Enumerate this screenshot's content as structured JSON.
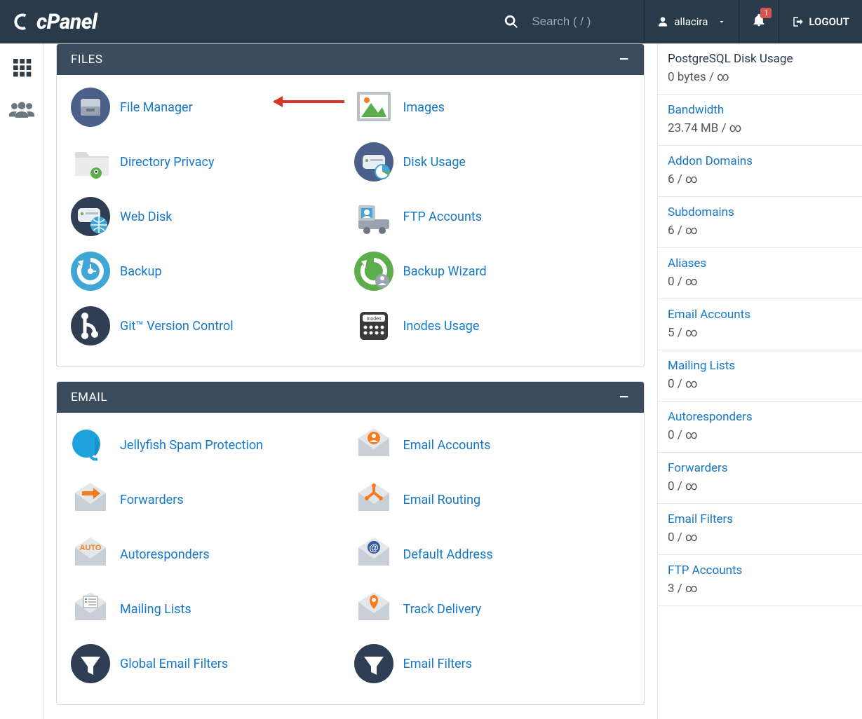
{
  "header": {
    "brand": "cPanel",
    "search_placeholder": "Search ( / )",
    "username": "allacira",
    "notification_count": "1",
    "logout_label": "LOGOUT"
  },
  "sections": [
    {
      "title": "FILES",
      "items": [
        {
          "label": "File Manager",
          "icon": "file-manager"
        },
        {
          "label": "Images",
          "icon": "images"
        },
        {
          "label": "Directory Privacy",
          "icon": "directory-privacy"
        },
        {
          "label": "Disk Usage",
          "icon": "disk-usage"
        },
        {
          "label": "Web Disk",
          "icon": "web-disk"
        },
        {
          "label": "FTP Accounts",
          "icon": "ftp-accounts"
        },
        {
          "label": "Backup",
          "icon": "backup"
        },
        {
          "label": "Backup Wizard",
          "icon": "backup-wizard"
        },
        {
          "label": "Git™ Version Control",
          "icon": "git"
        },
        {
          "label": "Inodes Usage",
          "icon": "inodes"
        }
      ]
    },
    {
      "title": "EMAIL",
      "items": [
        {
          "label": "Jellyfish Spam Protection",
          "icon": "jellyfish"
        },
        {
          "label": "Email Accounts",
          "icon": "email-accounts"
        },
        {
          "label": "Forwarders",
          "icon": "forwarders"
        },
        {
          "label": "Email Routing",
          "icon": "email-routing"
        },
        {
          "label": "Autoresponders",
          "icon": "autoresponders"
        },
        {
          "label": "Default Address",
          "icon": "default-address"
        },
        {
          "label": "Mailing Lists",
          "icon": "mailing-lists"
        },
        {
          "label": "Track Delivery",
          "icon": "track-delivery"
        },
        {
          "label": "Global Email Filters",
          "icon": "global-filters"
        },
        {
          "label": "Email Filters",
          "icon": "email-filters"
        }
      ]
    }
  ],
  "stats": [
    {
      "title": "PostgreSQL Disk Usage",
      "value": "0 bytes / ∞",
      "link": false
    },
    {
      "title": "Bandwidth",
      "value": "23.74 MB / ∞",
      "link": true
    },
    {
      "title": "Addon Domains",
      "value": "6 / ∞",
      "link": true
    },
    {
      "title": "Subdomains",
      "value": "6 / ∞",
      "link": true
    },
    {
      "title": "Aliases",
      "value": "0 / ∞",
      "link": true
    },
    {
      "title": "Email Accounts",
      "value": "5 / ∞",
      "link": true
    },
    {
      "title": "Mailing Lists",
      "value": "0 / ∞",
      "link": true
    },
    {
      "title": "Autoresponders",
      "value": "0 / ∞",
      "link": true
    },
    {
      "title": "Forwarders",
      "value": "0 / ∞",
      "link": true
    },
    {
      "title": "Email Filters",
      "value": "0 / ∞",
      "link": true
    },
    {
      "title": "FTP Accounts",
      "value": "3 / ∞",
      "link": true
    }
  ]
}
